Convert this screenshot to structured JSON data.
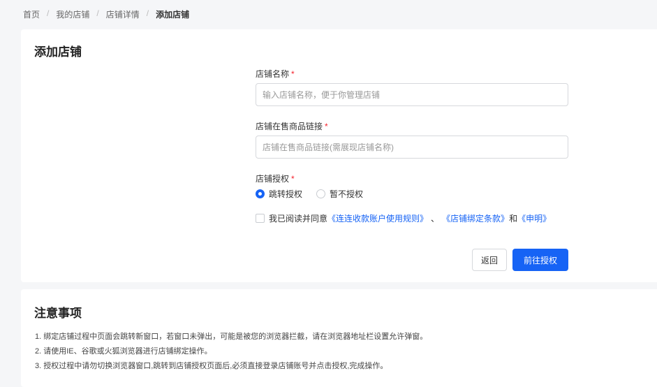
{
  "breadcrumb": [
    "首页",
    "我的店铺",
    "店铺详情",
    "添加店铺"
  ],
  "form": {
    "title": "添加店铺",
    "name_label": "店铺名称",
    "name_placeholder": "输入店铺名称，便于你管理店铺",
    "link_label": "店铺在售商品链接",
    "link_placeholder": "店铺在售商品链接(需展现店铺名称)",
    "auth_label": "店铺授权",
    "required_mark": "*",
    "auth_options": [
      "跳转授权",
      "暂不授权"
    ],
    "agree_prefix": "我已阅读并同意",
    "agree_link1": "《连连收款账户使用规则》",
    "agree_sep": "、",
    "agree_link2": "《店铺绑定条款》",
    "agree_and": "和",
    "agree_link3": "《申明》",
    "back_label": "返回",
    "submit_label": "前往授权"
  },
  "notes": {
    "title": "注意事项",
    "items": [
      "1. 绑定店铺过程中页面会跳转新窗口，若窗口未弹出，可能是被您的浏览器拦截，请在浏览器地址栏设置允许弹窗。",
      "2. 请使用IE、谷歌或火狐浏览器进行店铺绑定操作。",
      "3. 授权过程中请勿切换浏览器窗口,跳转到店铺授权页面后,必须直接登录店铺账号并点击授权,完成操作。"
    ]
  },
  "colors": {
    "primary": "#1663f5",
    "required": "#f5222d"
  }
}
